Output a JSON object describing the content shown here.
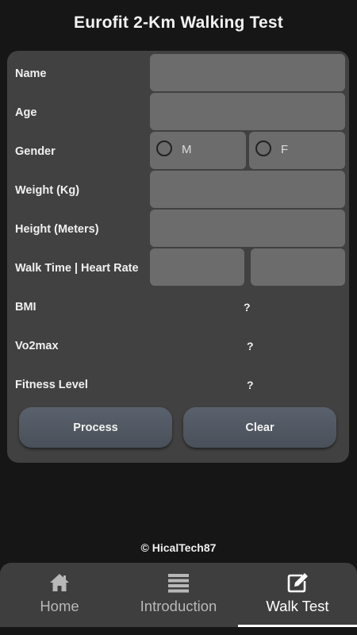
{
  "header": {
    "title": "Eurofit 2-Km Walking Test"
  },
  "form": {
    "name_label": "Name",
    "name_value": "",
    "age_label": "Age",
    "age_value": "",
    "gender_label": "Gender",
    "gender_male": "M",
    "gender_female": "F",
    "weight_label": "Weight (Kg)",
    "weight_value": "",
    "height_label": "Height (Meters)",
    "height_value": "",
    "walk_label": "Walk Time | Heart Rate",
    "walk_time_value": "",
    "heart_rate_value": ""
  },
  "results": {
    "bmi_label": "BMI",
    "bmi_value": "?",
    "vo2_label": "Vo2max",
    "vo2_value": "?",
    "fitness_label": "Fitness Level",
    "fitness_value": "?"
  },
  "buttons": {
    "process": "Process",
    "clear": "Clear"
  },
  "footer": {
    "copyright": "© HicalTech87"
  },
  "nav": {
    "items": [
      {
        "label": "Home",
        "icon": "home-icon"
      },
      {
        "label": "Introduction",
        "icon": "list-icon"
      },
      {
        "label": "Walk Test",
        "icon": "edit-icon"
      }
    ],
    "active_index": 2
  },
  "colors": {
    "background": "#161616",
    "card": "#414141",
    "field": "#6c6c6c",
    "navbar": "#3e3e3e"
  }
}
